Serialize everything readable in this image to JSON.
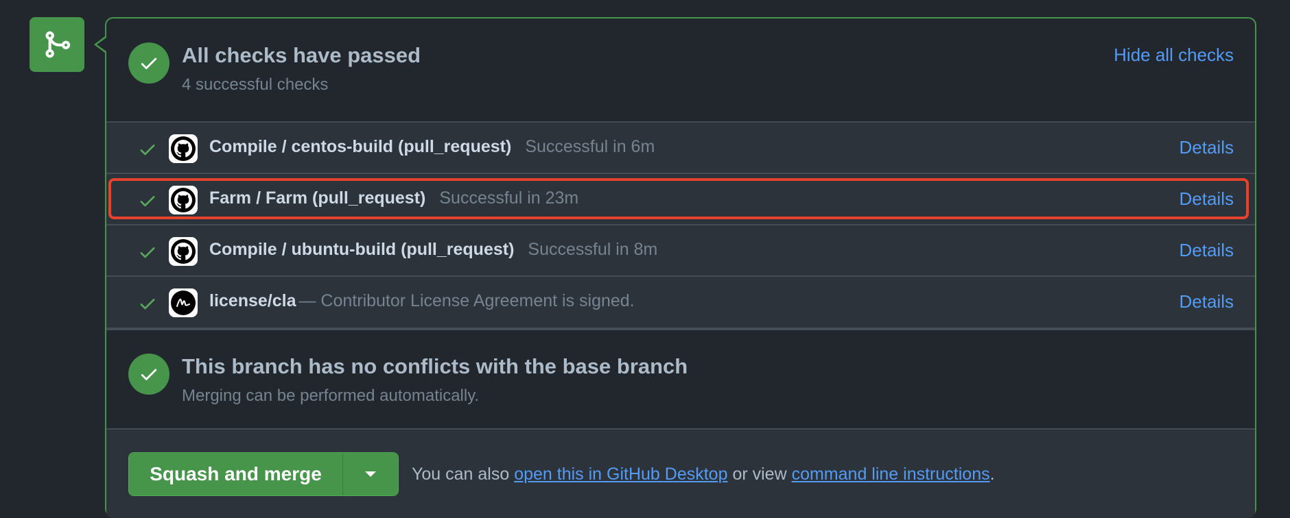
{
  "status": {
    "title": "All checks have passed",
    "subtitle": "4 successful checks",
    "hide_link": "Hide all checks"
  },
  "checks": [
    {
      "name": "Compile / centos-build (pull_request)",
      "description": "Successful in 6m",
      "avatar": "github-icon",
      "details": "Details"
    },
    {
      "name": "Farm / Farm (pull_request)",
      "description": "Successful in 23m",
      "avatar": "github-icon",
      "details": "Details"
    },
    {
      "name": "Compile / ubuntu-build (pull_request)",
      "description": "Successful in 8m",
      "avatar": "github-icon",
      "details": "Details"
    },
    {
      "name": "license/cla",
      "description": "— Contributor License Agreement is signed.",
      "avatar": "cla-signature-icon",
      "details": "Details"
    }
  ],
  "conflicts": {
    "title": "This branch has no conflicts with the base branch",
    "subtitle": "Merging can be performed automatically."
  },
  "merge": {
    "button_label": "Squash and merge",
    "hint_prefix": "You can also",
    "desktop_link": "open this in GitHub Desktop",
    "hint_middle": "or view",
    "cli_link": "command line instructions",
    "hint_suffix": "."
  },
  "colors": {
    "success_green": "#46954a",
    "link_blue": "#539bf5",
    "highlight_red": "#e5432c",
    "background": "#22272e"
  }
}
